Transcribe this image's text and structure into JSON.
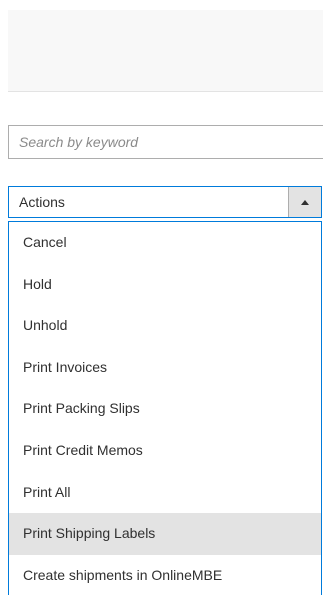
{
  "search": {
    "placeholder": "Search by keyword",
    "value": ""
  },
  "actions": {
    "label": "Actions",
    "toggle_icon": "caret-up-icon",
    "items": [
      {
        "label": "Cancel"
      },
      {
        "label": "Hold"
      },
      {
        "label": "Unhold"
      },
      {
        "label": "Print Invoices"
      },
      {
        "label": "Print Packing Slips"
      },
      {
        "label": "Print Credit Memos"
      },
      {
        "label": "Print All"
      },
      {
        "label": "Print Shipping Labels",
        "highlighted": true
      },
      {
        "label": "Create shipments in OnlineMBE"
      }
    ]
  },
  "colors": {
    "focus_border": "#007bdb",
    "highlight": "#e3e3e3",
    "text": "#303030"
  }
}
